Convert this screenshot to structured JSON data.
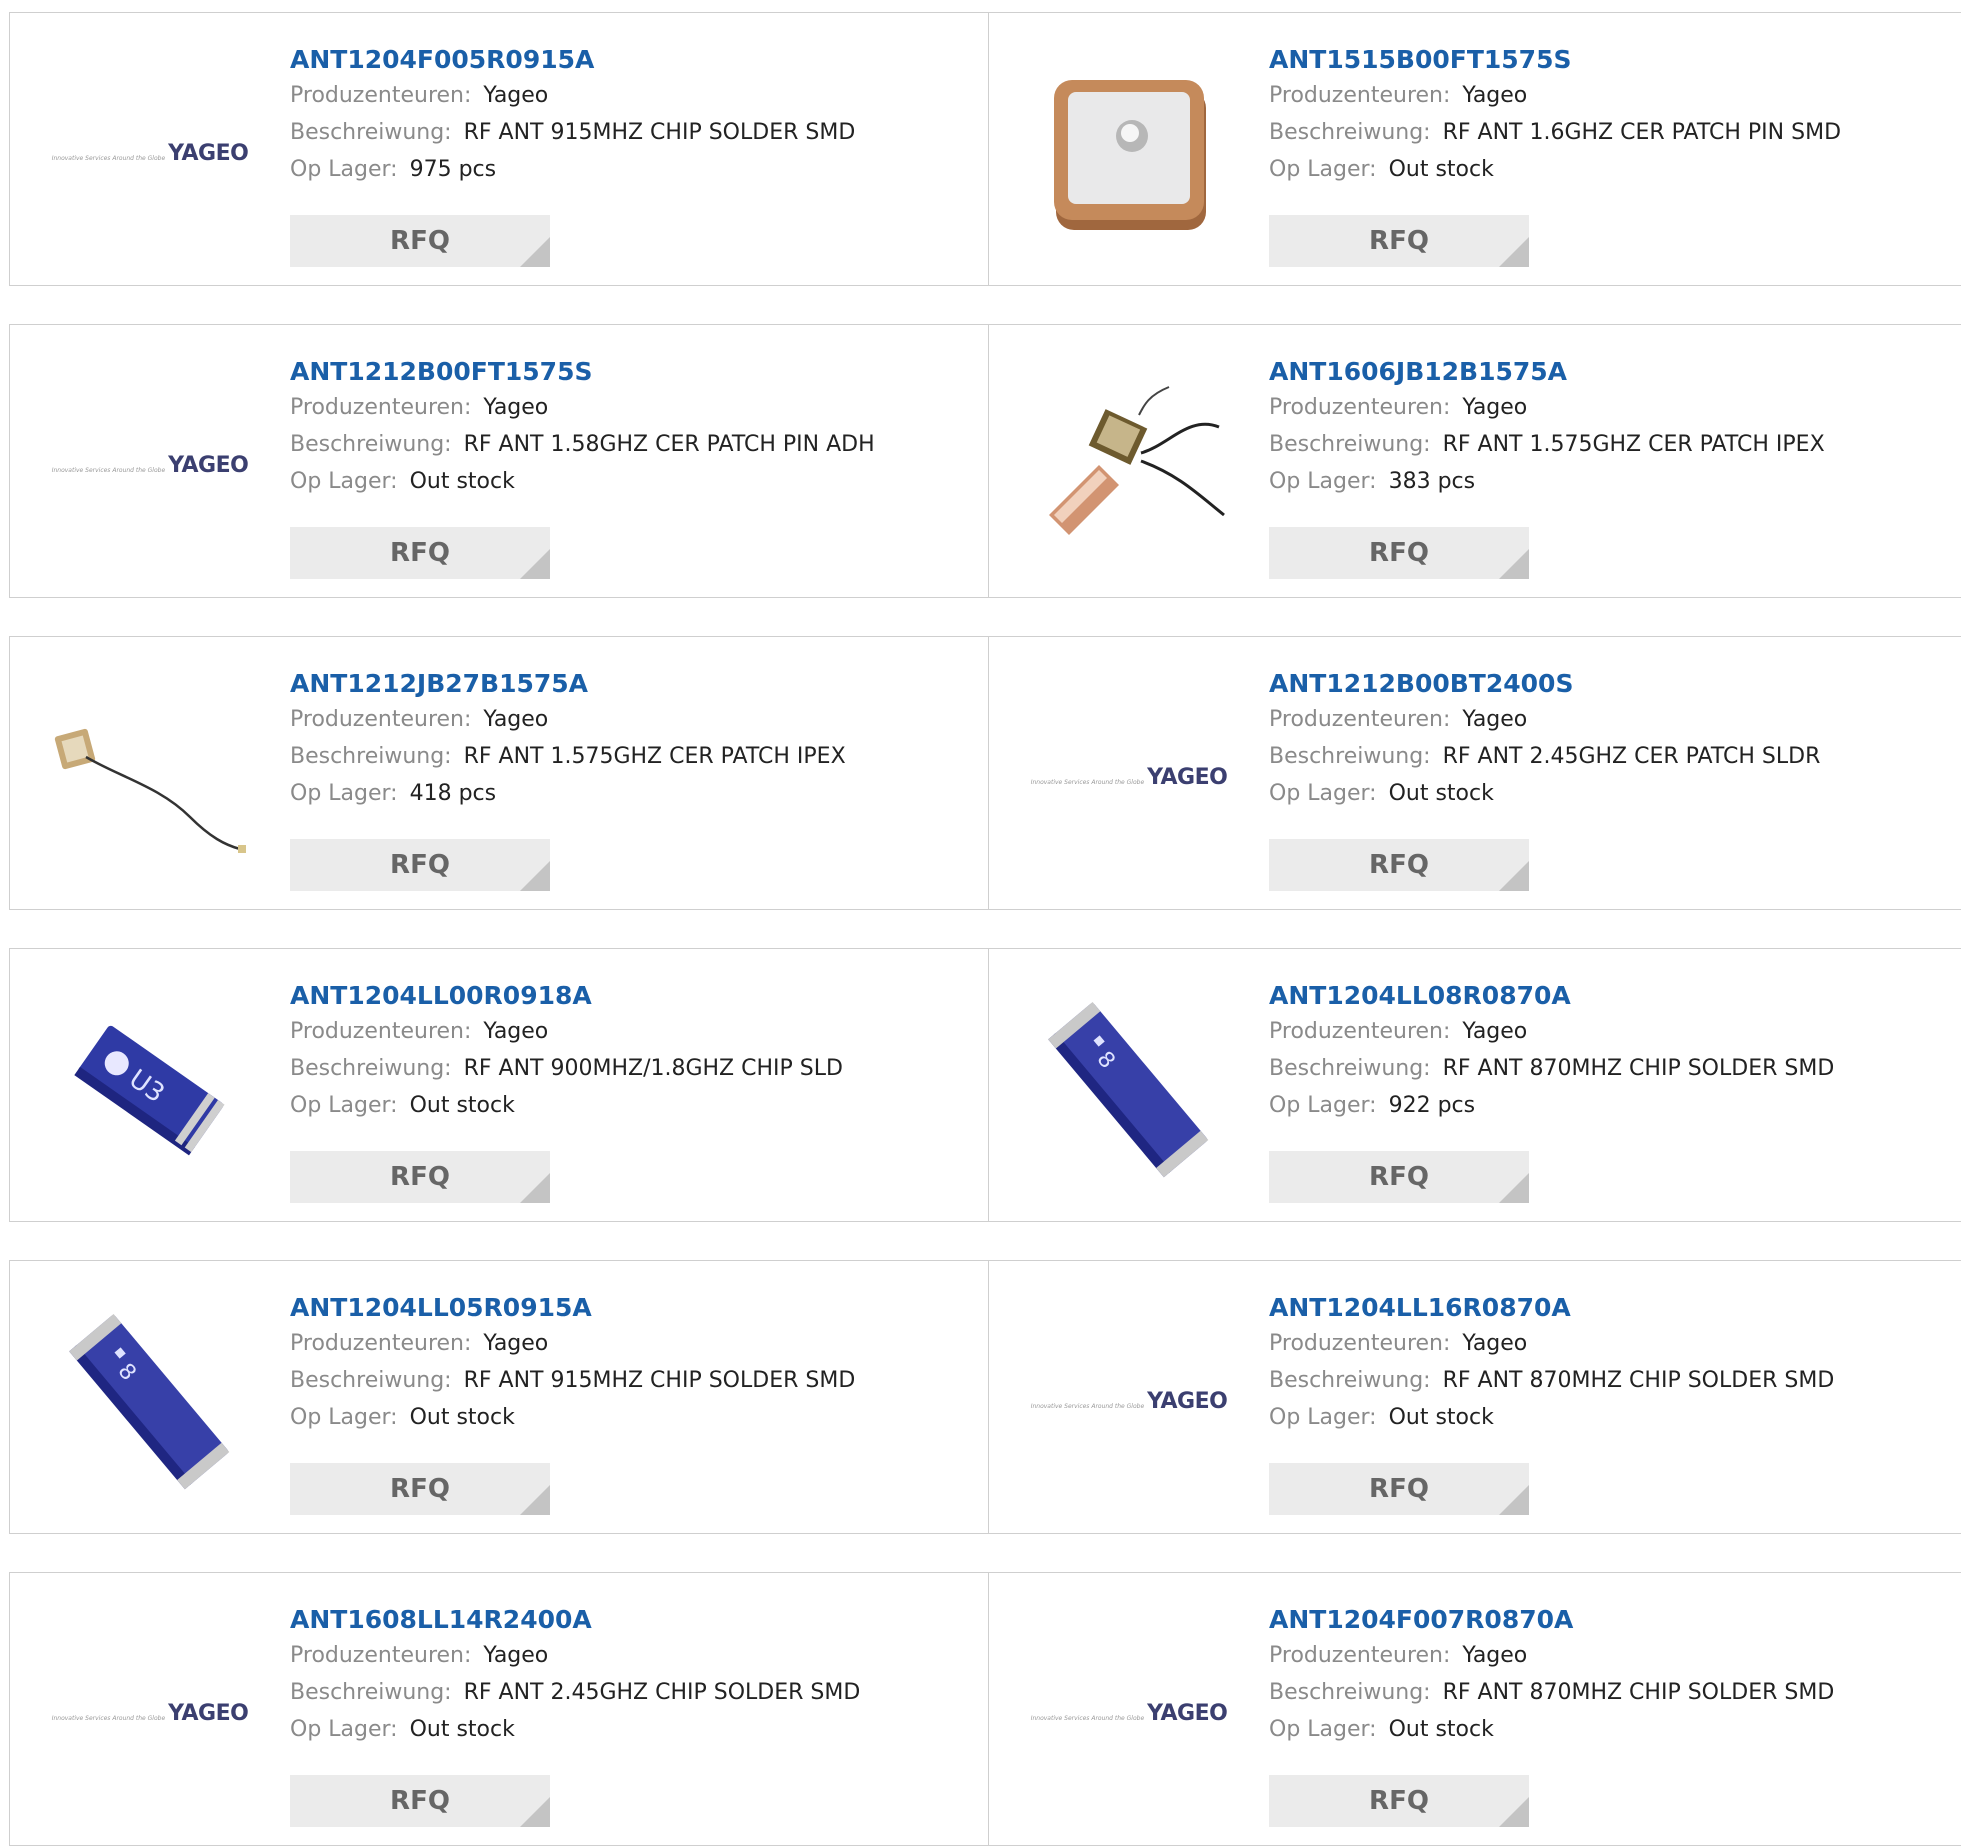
{
  "labels": {
    "manufacturer": "Produzenteuren:",
    "description": "Beschreiwung:",
    "stock": "Op Lager:",
    "rfq": "RFQ"
  },
  "logo": {
    "tagline": "Innovative Services Around the Globe",
    "brand": "YAGEO"
  },
  "products": [
    {
      "part": "ANT1204F005R0915A",
      "manufacturer": "Yageo",
      "description": "RF ANT 915MHZ CHIP SOLDER SMD",
      "stock": "975 pcs",
      "image": "yageo-logo"
    },
    {
      "part": "ANT1515B00FT1575S",
      "manufacturer": "Yageo",
      "description": "RF ANT 1.6GHZ CER PATCH PIN SMD",
      "stock": "Out stock",
      "image": "ceramic-patch-antenna"
    },
    {
      "part": "ANT1212B00FT1575S",
      "manufacturer": "Yageo",
      "description": "RF ANT 1.58GHZ CER PATCH PIN ADH",
      "stock": "Out stock",
      "image": "yageo-logo"
    },
    {
      "part": "ANT1606JB12B1575A",
      "manufacturer": "Yageo",
      "description": "RF ANT 1.575GHZ CER PATCH IPEX",
      "stock": "383 pcs",
      "image": "patch-cable-antenna"
    },
    {
      "part": "ANT1212JB27B1575A",
      "manufacturer": "Yageo",
      "description": "RF ANT 1.575GHZ CER PATCH IPEX",
      "stock": "418 pcs",
      "image": "small-patch-cable-antenna"
    },
    {
      "part": "ANT1212B00BT2400S",
      "manufacturer": "Yageo",
      "description": "RF ANT 2.45GHZ CER PATCH SLDR",
      "stock": "Out stock",
      "image": "yageo-logo"
    },
    {
      "part": "ANT1204LL00R0918A",
      "manufacturer": "Yageo",
      "description": "RF ANT 900MHZ/1.8GHZ CHIP SLD",
      "stock": "Out stock",
      "image": "blue-chip-antenna-short"
    },
    {
      "part": "ANT1204LL08R0870A",
      "manufacturer": "Yageo",
      "description": "RF ANT 870MHZ CHIP SOLDER SMD",
      "stock": "922 pcs",
      "image": "blue-chip-antenna-long"
    },
    {
      "part": "ANT1204LL05R0915A",
      "manufacturer": "Yageo",
      "description": "RF ANT 915MHZ CHIP SOLDER SMD",
      "stock": "Out stock",
      "image": "blue-chip-antenna-long"
    },
    {
      "part": "ANT1204LL16R0870A",
      "manufacturer": "Yageo",
      "description": "RF ANT 870MHZ CHIP SOLDER SMD",
      "stock": "Out stock",
      "image": "yageo-logo"
    },
    {
      "part": "ANT1608LL14R2400A",
      "manufacturer": "Yageo",
      "description": "RF ANT 2.45GHZ CHIP SOLDER SMD",
      "stock": "Out stock",
      "image": "yageo-logo"
    },
    {
      "part": "ANT1204F007R0870A",
      "manufacturer": "Yageo",
      "description": "RF ANT 870MHZ CHIP SOLDER SMD",
      "stock": "Out stock",
      "image": "yageo-logo"
    }
  ]
}
